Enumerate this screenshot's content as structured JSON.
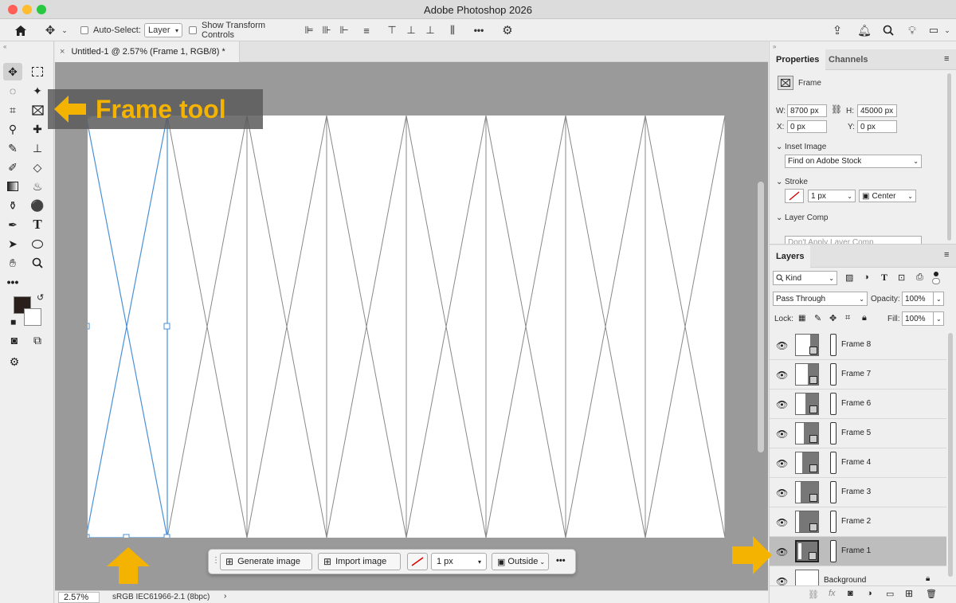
{
  "window": {
    "title": "Adobe Photoshop 2026"
  },
  "options_bar": {
    "auto_select_label": "Auto-Select:",
    "auto_select_value": "Layer",
    "show_transform_label": "Show Transform Controls",
    "more_label": "•••"
  },
  "document": {
    "tab_title": "Untitled-1 @ 2.57% (Frame 1, RGB/8) *"
  },
  "status": {
    "zoom": "2.57%",
    "profile": "sRGB IEC61966-2.1 (8bpc)"
  },
  "callout": {
    "text": "Frame tool"
  },
  "context_bar": {
    "generate_label": "Generate image",
    "import_label": "Import image",
    "stroke_size": "1 px",
    "stroke_position": "Outside",
    "more_label": "•••"
  },
  "properties": {
    "tab_properties": "Properties",
    "tab_channels": "Channels",
    "kind_label": "Frame",
    "w_label": "W:",
    "w_value": "8700 px",
    "h_label": "H:",
    "h_value": "45000 px",
    "x_label": "X:",
    "x_value": "0 px",
    "y_label": "Y:",
    "y_value": "0 px",
    "inset_image_label": "Inset Image",
    "inset_image_value": "Find on Adobe Stock",
    "stroke_label": "Stroke",
    "stroke_size": "1 px",
    "stroke_align": "Center",
    "layer_comp_label": "Layer Comp",
    "layer_comp_value": "Don't Apply Layer Comp"
  },
  "layers_panel": {
    "tab": "Layers",
    "filter_kind": "Kind",
    "blend_mode": "Pass Through",
    "opacity_label": "Opacity:",
    "opacity_value": "100%",
    "lock_label": "Lock:",
    "fill_label": "Fill:",
    "fill_value": "100%",
    "layers": [
      {
        "name": "Frame 8"
      },
      {
        "name": "Frame 7"
      },
      {
        "name": "Frame 6"
      },
      {
        "name": "Frame 5"
      },
      {
        "name": "Frame 4"
      },
      {
        "name": "Frame 3"
      },
      {
        "name": "Frame 2"
      },
      {
        "name": "Frame 1",
        "selected": true
      },
      {
        "name": "Background"
      }
    ]
  },
  "colors": {
    "accent_arrow": "#f5b301",
    "selection": "#4a90d9",
    "selected_row": "#bdbdbd"
  }
}
